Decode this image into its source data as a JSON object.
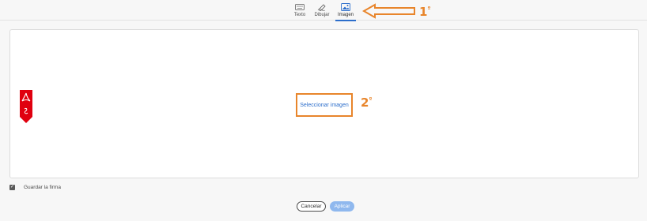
{
  "tabs": [
    {
      "label": "Texto",
      "icon": "keyboard-icon",
      "active": false
    },
    {
      "label": "Dibujar",
      "icon": "pen-draw-icon",
      "active": false
    },
    {
      "label": "Imagen",
      "icon": "image-icon",
      "active": true
    }
  ],
  "annotations": {
    "first": {
      "number": "1",
      "suffix": "º"
    },
    "second": {
      "number": "2",
      "suffix": "º"
    },
    "color": "#e8852b"
  },
  "canvas": {
    "select_image_label": "Seleccionar imagen",
    "logo": "acrobat-signature-logo"
  },
  "save_signature": {
    "label": "Guardar la firma",
    "checked": true
  },
  "buttons": {
    "cancel": "Cancelar",
    "apply": "Aplicar"
  },
  "colors": {
    "accent": "#2c6ecb",
    "apply_disabled": "#8fb8ee",
    "annotation": "#e8852b",
    "logo_red": "#e0000f"
  }
}
